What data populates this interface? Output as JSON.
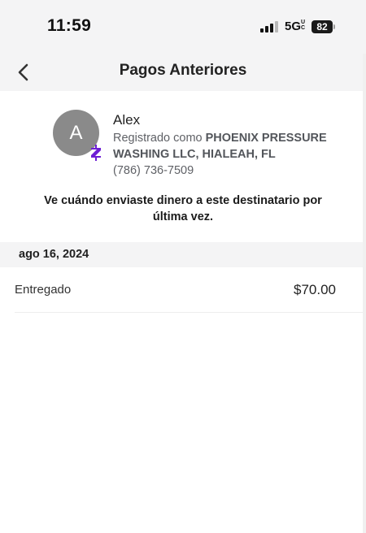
{
  "status_bar": {
    "time": "11:59",
    "network": "5G",
    "network_suffix": "UC",
    "battery": "82",
    "signal_icon": "cellular-signal-icon"
  },
  "nav": {
    "title": "Pagos Anteriores",
    "back_icon": "chevron-left-icon"
  },
  "contact": {
    "avatar_initial": "A",
    "badge_icon": "zelle-logo-icon",
    "badge_color": "#6d1ed4",
    "name": "Alex",
    "registered_prefix": "Registrado como",
    "registered_name": "PHOENIX PRESSURE WASHING LLC, HIALEAH, FL",
    "phone": "(786) 736-7509"
  },
  "description": "Ve cuándo enviaste dinero a este destinatario por última vez.",
  "payments": [
    {
      "date": "ago 16, 2024",
      "status": "Entregado",
      "amount": "$70.00"
    }
  ]
}
